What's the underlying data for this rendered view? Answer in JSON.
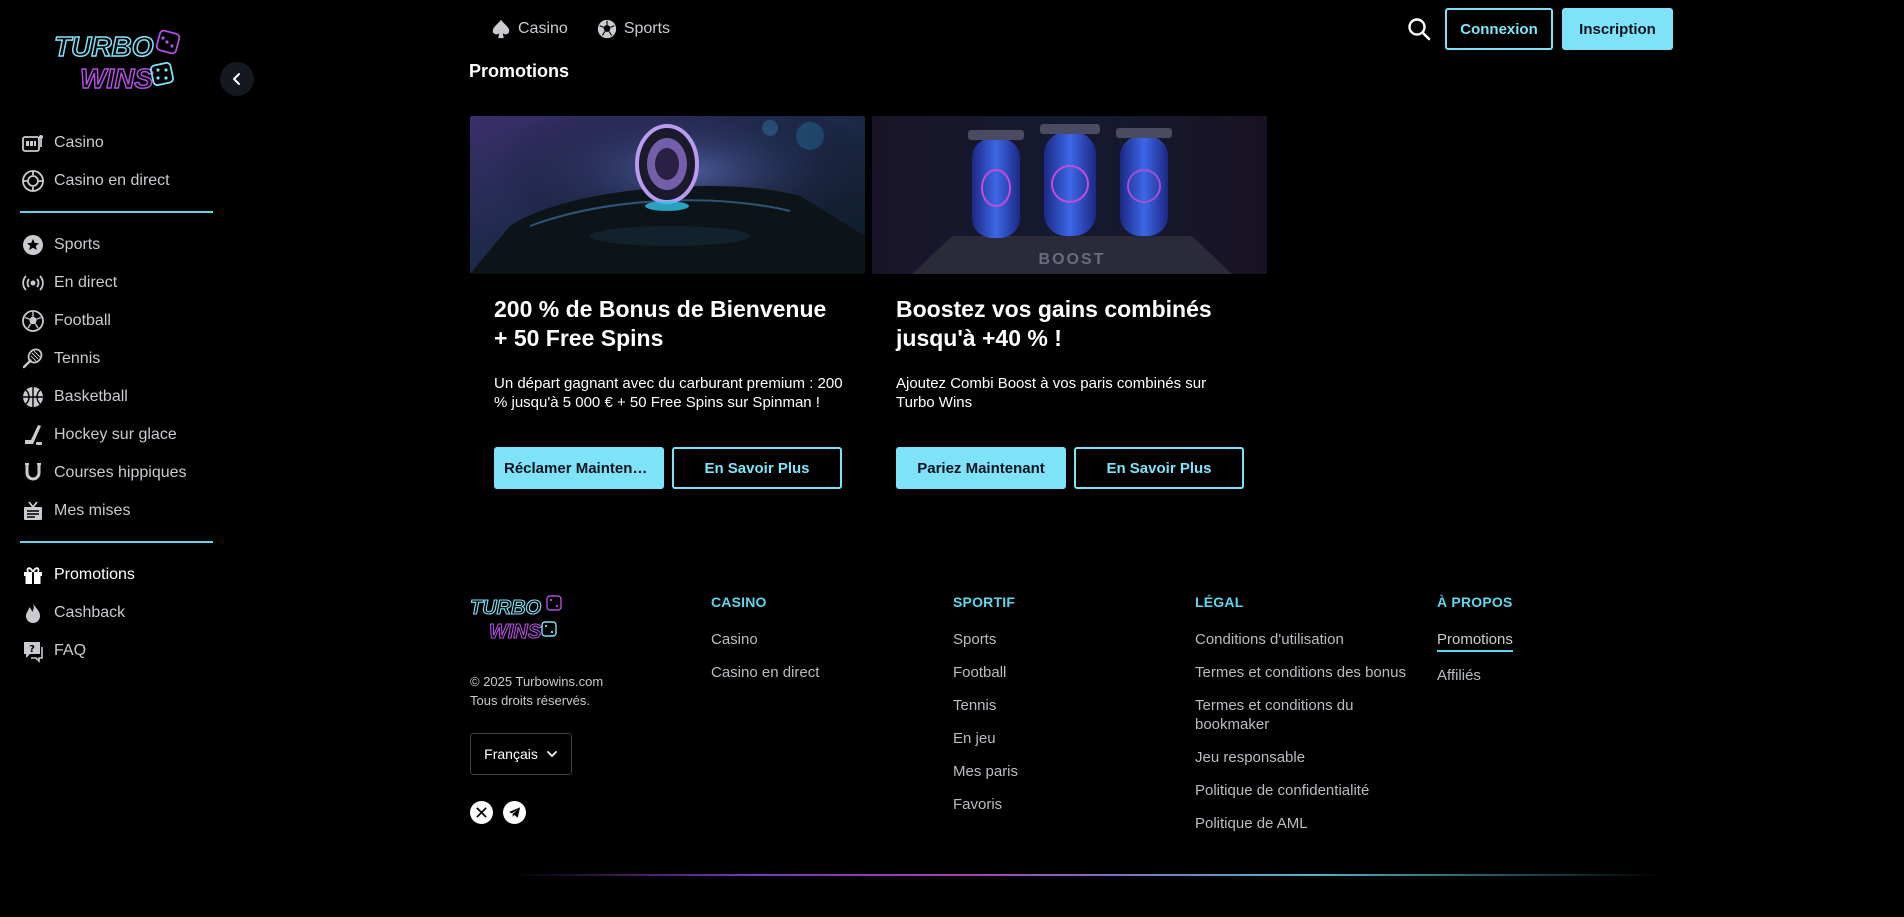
{
  "brand": {
    "logo_text_line1": "TURBO",
    "logo_text_line2": "WINS",
    "accent_color": "#7ee3f9",
    "purple_color": "#8b3fd8"
  },
  "sidebar": {
    "groups": [
      [
        {
          "label": "Casino",
          "icon": "slot-machine-icon"
        },
        {
          "label": "Casino en direct",
          "icon": "live-casino-chip-icon"
        }
      ],
      [
        {
          "label": "Sports",
          "icon": "sports-star-icon"
        },
        {
          "label": "En direct",
          "icon": "live-broadcast-icon"
        },
        {
          "label": "Football",
          "icon": "football-icon"
        },
        {
          "label": "Tennis",
          "icon": "tennis-racket-icon"
        },
        {
          "label": "Basketball",
          "icon": "basketball-icon"
        },
        {
          "label": "Hockey sur glace",
          "icon": "hockey-stick-icon"
        },
        {
          "label": "Courses hippiques",
          "icon": "horseshoe-icon"
        },
        {
          "label": "Mes mises",
          "icon": "bet-slip-icon"
        }
      ],
      [
        {
          "label": "Promotions",
          "icon": "gift-icon",
          "active": true
        },
        {
          "label": "Cashback",
          "icon": "flame-icon"
        },
        {
          "label": "FAQ",
          "icon": "chat-question-icon"
        }
      ]
    ]
  },
  "topbar": {
    "nav": [
      {
        "label": "Casino",
        "icon": "spade-icon"
      },
      {
        "label": "Sports",
        "icon": "soccer-ball-icon"
      }
    ],
    "login_label": "Connexion",
    "signup_label": "Inscription"
  },
  "page": {
    "title": "Promotions"
  },
  "promos": [
    {
      "title": "200 % de Bonus de Bienvenue + 50 Free Spins",
      "description": "Un départ gagnant avec du carburant premium : 200 % jusqu'à 5 000 € + 50 Free Spins sur Spinman !",
      "primary_label": "Réclamer Maintenant",
      "secondary_label": "En Savoir Plus"
    },
    {
      "title": "Boostez vos gains combinés jusqu'à +40 % !",
      "description": "Ajoutez Combi Boost à vos paris combinés sur Turbo Wins",
      "primary_label": "Pariez Maintenant",
      "secondary_label": "En Savoir Plus",
      "image_text": "BOOST"
    }
  ],
  "footer": {
    "copyright_line1": "© 2025 Turbowins.com",
    "copyright_line2": "Tous droits réservés.",
    "language": "Français",
    "columns": [
      {
        "heading": "CASINO",
        "links": [
          "Casino",
          "Casino en direct"
        ]
      },
      {
        "heading": "SPORTIF",
        "links": [
          "Sports",
          "Football",
          "Tennis",
          "En jeu",
          "Mes paris",
          "Favoris"
        ]
      },
      {
        "heading": "LÉGAL",
        "links": [
          "Conditions d'utilisation",
          "Termes et conditions des bonus",
          "Termes et conditions du bookmaker",
          "Jeu responsable",
          "Politique de confidentialité",
          "Politique de AML"
        ]
      },
      {
        "heading": "À PROPOS",
        "links": [
          "Promotions",
          "Affiliés"
        ]
      }
    ]
  }
}
